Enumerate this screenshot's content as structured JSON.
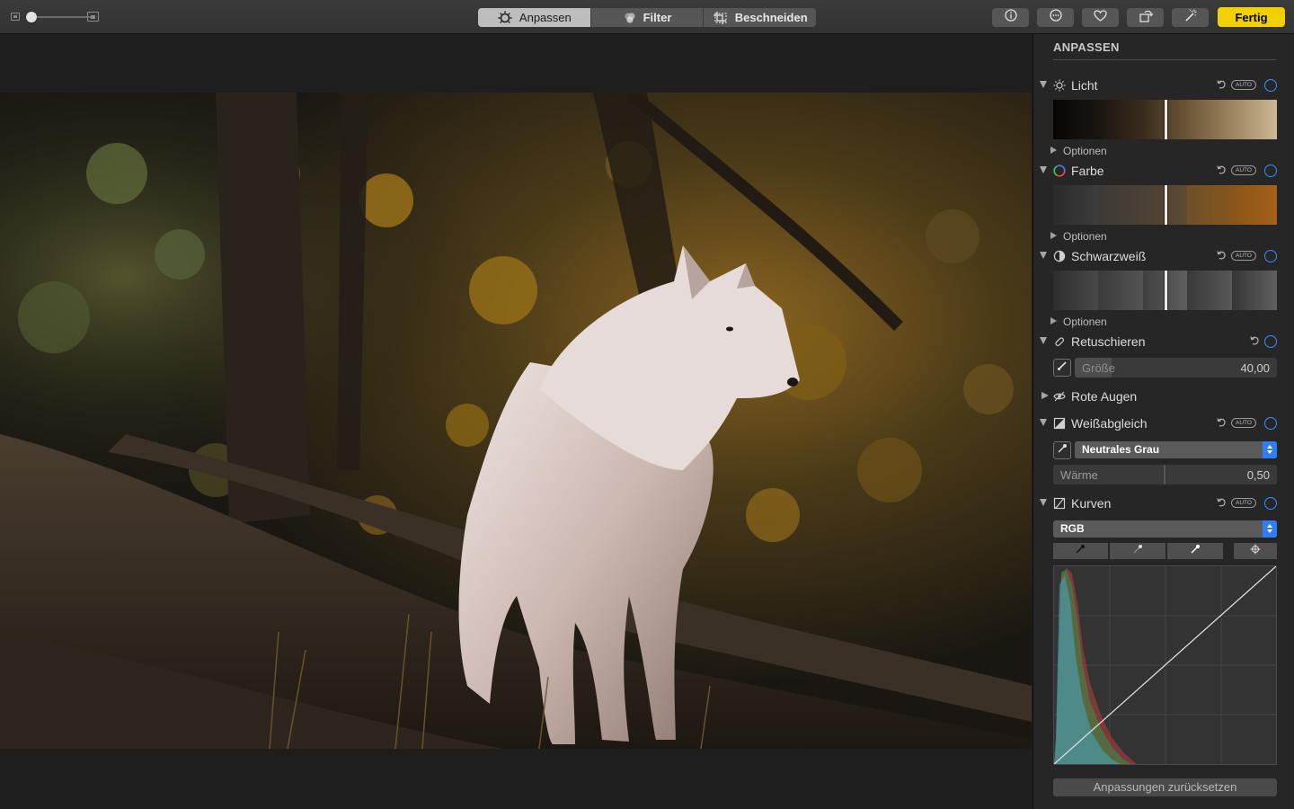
{
  "toolbar": {
    "tabs": [
      {
        "label": "Anpassen",
        "icon": "adjust-icon",
        "active": true
      },
      {
        "label": "Filter",
        "icon": "filter-icon",
        "active": false
      },
      {
        "label": "Beschneiden",
        "icon": "crop-icon",
        "active": false
      }
    ],
    "buttons": [
      "info-icon",
      "more-icon",
      "heart-icon",
      "rotate-icon",
      "magic-wand-icon"
    ],
    "done_label": "Fertig",
    "accent": "#f2d000"
  },
  "sidebar": {
    "title": "ANPASSEN",
    "options_label": "Optionen",
    "auto_label": "AUTO",
    "sections": {
      "light": {
        "label": "Licht",
        "icon": "sun-icon"
      },
      "color": {
        "label": "Farbe",
        "icon": "color-wheel-icon"
      },
      "bw": {
        "label": "Schwarzweiß",
        "icon": "half-circle-icon"
      },
      "retouch": {
        "label": "Retuschieren",
        "icon": "bandage-icon",
        "size_label": "Größe",
        "size_value": "40,00",
        "size_fraction": 0.18
      },
      "redeye": {
        "label": "Rote Augen",
        "icon": "eye-icon"
      },
      "whitebalance": {
        "label": "Weißabgleich",
        "icon": "white-balance-icon",
        "mode": "Neutrales Grau",
        "warmth_label": "Wärme",
        "warmth_value": "0,50"
      },
      "curves": {
        "label": "Kurven",
        "icon": "curves-icon",
        "channel": "RGB"
      }
    },
    "reset_label": "Anpassungen zurücksetzen",
    "link_color": "#3a8dff"
  }
}
